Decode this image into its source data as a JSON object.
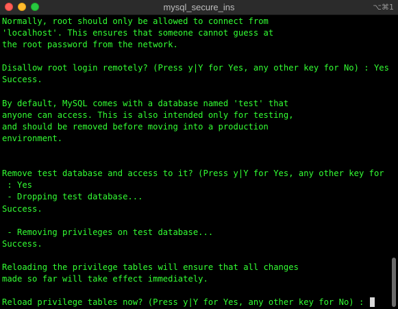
{
  "window": {
    "title": "mysql_secure_ins",
    "shortcut": "⌥⌘1"
  },
  "colors": {
    "terminal_text": "#33ff33",
    "terminal_background": "#000000",
    "cursor": "#d9d9d9"
  },
  "terminal": {
    "lines": [
      "Normally, root should only be allowed to connect from",
      "'localhost'. This ensures that someone cannot guess at",
      "the root password from the network.",
      "",
      "Disallow root login remotely? (Press y|Y for Yes, any other key for No) : Yes",
      "Success.",
      "",
      "By default, MySQL comes with a database named 'test' that",
      "anyone can access. This is also intended only for testing,",
      "and should be removed before moving into a production",
      "environment.",
      "",
      "",
      "Remove test database and access to it? (Press y|Y for Yes, any other key for No)",
      " : Yes",
      " - Dropping test database...",
      "Success.",
      "",
      " - Removing privileges on test database...",
      "Success.",
      "",
      "Reloading the privilege tables will ensure that all changes",
      "made so far will take effect immediately.",
      "",
      "Reload privilege tables now? (Press y|Y for Yes, any other key for No) : "
    ]
  }
}
